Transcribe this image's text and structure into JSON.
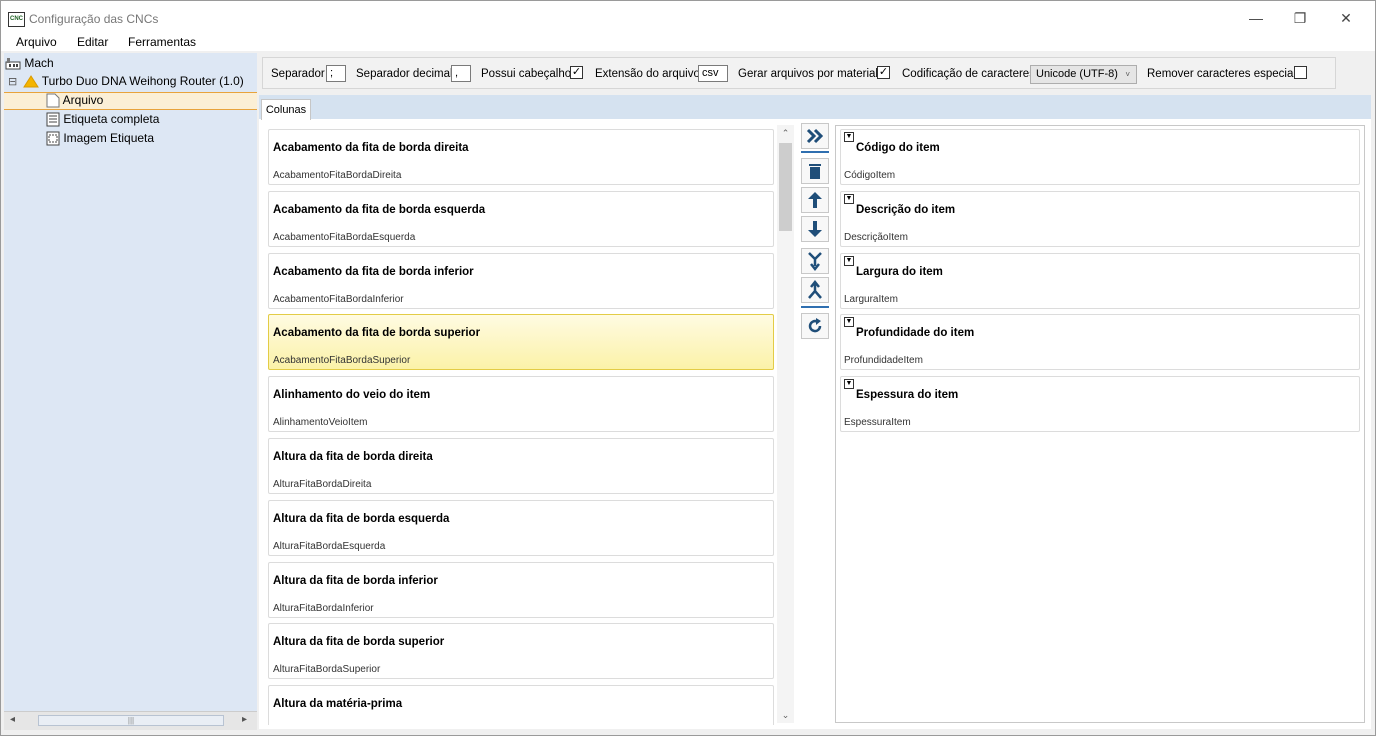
{
  "window": {
    "title": "Configuração das CNCs",
    "controls": {
      "minimize": "—",
      "maximize": "❐",
      "close": "✕"
    },
    "app_icon_text": "CNC"
  },
  "menu": [
    "Arquivo",
    "Editar",
    "Ferramentas"
  ],
  "tree": {
    "root": "Mach",
    "machine": "Turbo Duo DNA Weihong Router (1.0)",
    "expander": "⊟",
    "items": [
      "Arquivo",
      "Etiqueta completa",
      "Imagem Etiqueta"
    ],
    "selected": "Arquivo"
  },
  "options": {
    "separator_label": "Separador",
    "separator_value": ";",
    "decimal_label": "Separador decimal",
    "decimal_value": ",",
    "header_label": "Possui cabeçalho",
    "header_checked": true,
    "extension_label": "Extensão do arquivo",
    "extension_value": "csv",
    "per_material_label": "Gerar arquivos por material",
    "per_material_checked": true,
    "encoding_label": "Codificação de caracteres",
    "encoding_value": "Unicode (UTF-8)",
    "remove_special_label": "Remover caracteres especiais",
    "remove_special_checked": false,
    "check_glyph": "✓"
  },
  "tab": "Colunas",
  "available_columns": [
    {
      "title": "Acabamento da fita de borda direita",
      "key": "AcabamentoFitaBordaDireita"
    },
    {
      "title": "Acabamento da fita de borda esquerda",
      "key": "AcabamentoFitaBordaEsquerda"
    },
    {
      "title": "Acabamento da fita de borda inferior",
      "key": "AcabamentoFitaBordaInferior"
    },
    {
      "title": "Acabamento da fita de borda superior",
      "key": "AcabamentoFitaBordaSuperior"
    },
    {
      "title": "Alinhamento do veio do item",
      "key": "AlinhamentoVeioItem"
    },
    {
      "title": "Altura da fita de borda direita",
      "key": "AlturaFitaBordaDireita"
    },
    {
      "title": "Altura da fita de borda esquerda",
      "key": "AlturaFitaBordaEsquerda"
    },
    {
      "title": "Altura da fita de borda inferior",
      "key": "AlturaFitaBordaInferior"
    },
    {
      "title": "Altura da fita de borda superior",
      "key": "AlturaFitaBordaSuperior"
    },
    {
      "title": "Altura da matéria-prima",
      "key": ""
    }
  ],
  "selected_available_index": 3,
  "action_buttons": [
    {
      "name": "add-column-button",
      "icon": "»"
    },
    {
      "name": "remove-column-button",
      "icon": "🗑"
    },
    {
      "name": "move-up-button",
      "icon": "↑"
    },
    {
      "name": "move-down-button",
      "icon": "↓"
    },
    {
      "name": "move-bottom-button",
      "icon": "⤓"
    },
    {
      "name": "move-top-button",
      "icon": "⤒"
    },
    {
      "name": "reset-button",
      "icon": "⟳"
    }
  ],
  "selected_columns": [
    {
      "title": "Código do item",
      "key": "CódigoItem"
    },
    {
      "title": "Descrição do item",
      "key": "DescriçãoItem"
    },
    {
      "title": "Largura do item",
      "key": "LarguraItem"
    },
    {
      "title": "Profundidade do item",
      "key": "ProfundidadeItem"
    },
    {
      "title": "Espessura do item",
      "key": "EspessuraItem"
    }
  ],
  "scroll": {
    "up": "⌃",
    "down": "⌄",
    "left": "◂",
    "right": "▸",
    "grip": "|||"
  }
}
